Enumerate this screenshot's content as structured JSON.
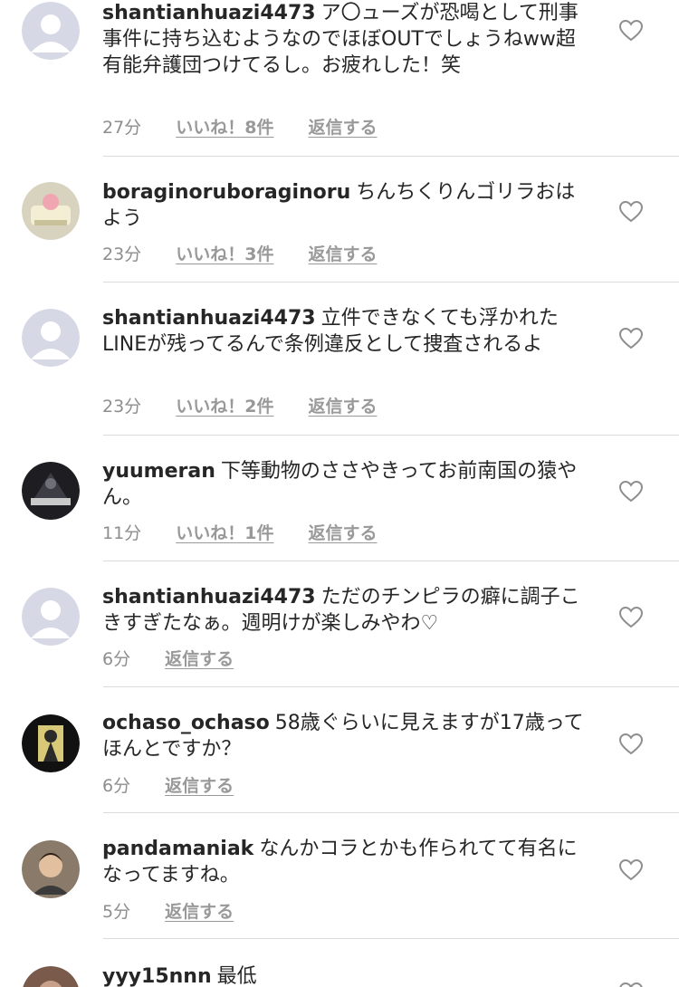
{
  "comments": [
    {
      "username": "shantianhuazi4473",
      "text": "ア〇ューズが恐喝として刑事事件に持ち込むようなのでほぼOUTでしょうねww超有能弁護団つけてるし。お疲れした！笑",
      "time": "27分",
      "likes": "いいね！8件",
      "reply": "返信する",
      "avatar": "default-avatar-icon"
    },
    {
      "username": "boraginoruboraginoru",
      "text": "ちんちくりんゴリラおはよう",
      "time": "23分",
      "likes": "いいね！3件",
      "reply": "返信する",
      "avatar": "sweets-photo"
    },
    {
      "username": "shantianhuazi4473",
      "text": "立件できなくても浮かれたLINEが残ってるんで条例違反として捜査されるよ",
      "time": "23分",
      "likes": "いいね！2件",
      "reply": "返信する",
      "avatar": "default-avatar-icon"
    },
    {
      "username": "yuumeran",
      "text": "下等動物のささやきってお前南国の猿やん。",
      "time": "11分",
      "likes": "いいね！1件",
      "reply": "返信する",
      "avatar": "sky-hi-photo"
    },
    {
      "username": "shantianhuazi4473",
      "text": "ただのチンピラの癖に調子こきすぎたなぁ。週明けが楽しみやわ♡",
      "time": "6分",
      "likes": "",
      "reply": "返信する",
      "avatar": "default-avatar-icon"
    },
    {
      "username": "ochaso_ochaso",
      "text": "58歳ぐらいに見えますが17歳ってほんとですか？",
      "time": "6分",
      "likes": "",
      "reply": "返信する",
      "avatar": "illustration-avatar"
    },
    {
      "username": "pandamaniak",
      "text": "なんかコラとかも作られてて有名になってますね。",
      "time": "5分",
      "likes": "",
      "reply": "返信する",
      "avatar": "man-photo"
    },
    {
      "username": "yyy15nnn",
      "text": "最低",
      "time": "",
      "likes": "",
      "reply": "",
      "avatar": "person-photo"
    }
  ],
  "colors": {
    "text": "#262626",
    "meta": "#8e8e8e",
    "divider": "#dbdbdb",
    "placeholder_bg": "#d6d8e6",
    "placeholder_fg": "#ffffff"
  }
}
